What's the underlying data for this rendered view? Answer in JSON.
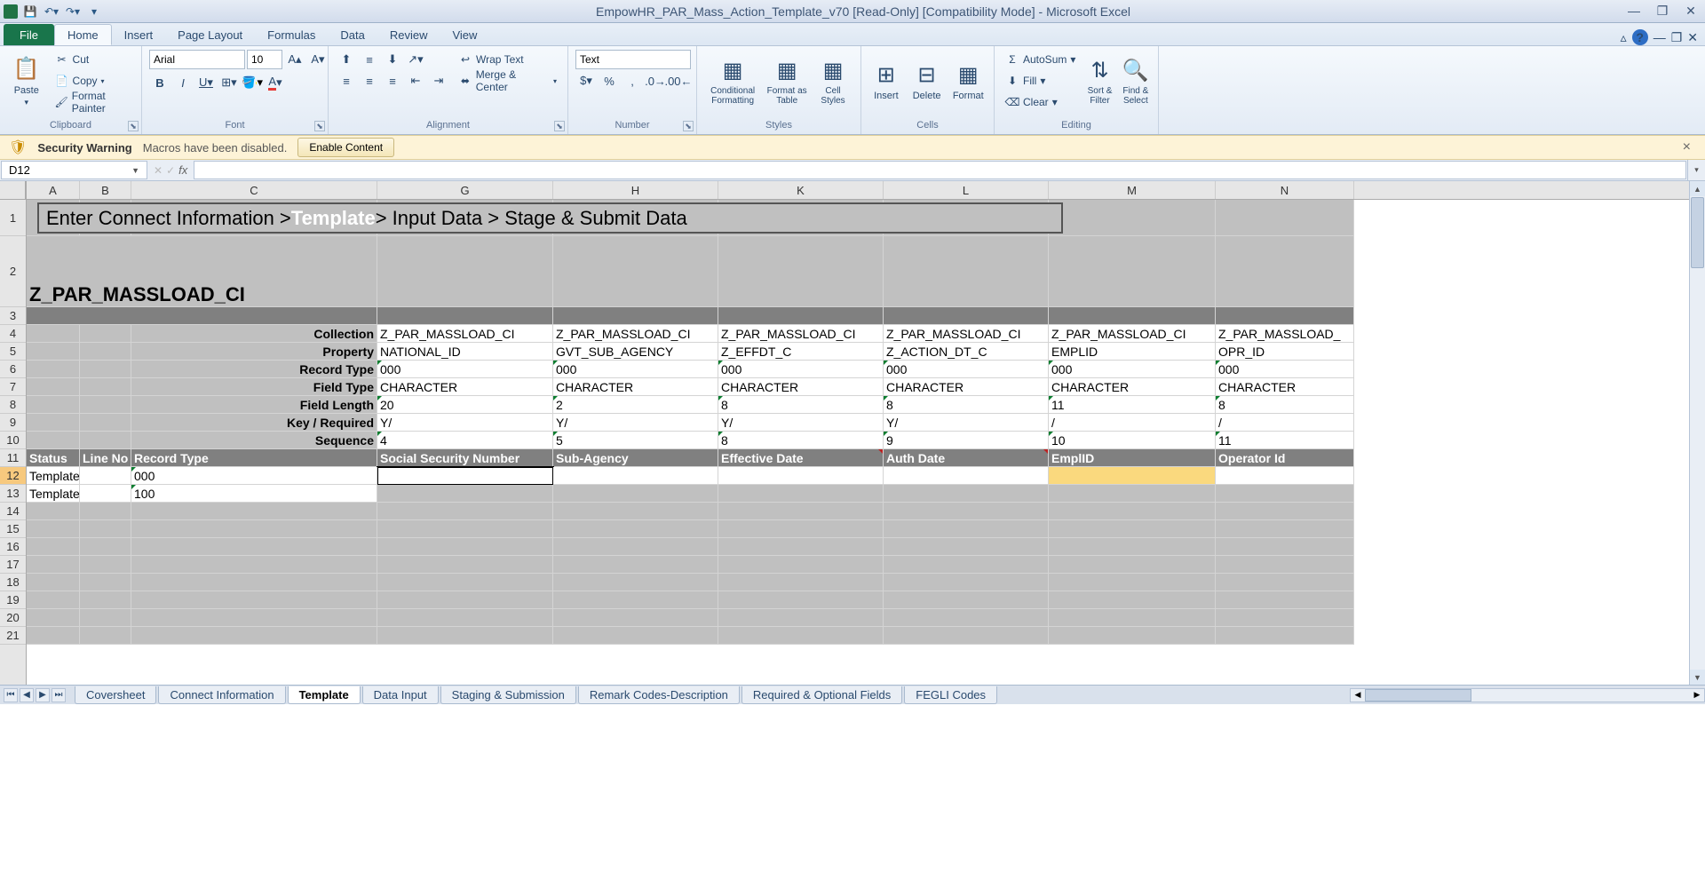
{
  "title": "EmpowHR_PAR_Mass_Action_Template_v70  [Read-Only]  [Compatibility Mode] - Microsoft Excel",
  "tabs": {
    "file": "File",
    "home": "Home",
    "insert": "Insert",
    "pagelayout": "Page Layout",
    "formulas": "Formulas",
    "data": "Data",
    "review": "Review",
    "view": "View"
  },
  "clipboard": {
    "paste": "Paste",
    "cut": "Cut",
    "copy": "Copy",
    "format_painter": "Format Painter",
    "label": "Clipboard"
  },
  "font": {
    "name": "Arial",
    "size": "10",
    "label": "Font"
  },
  "alignment": {
    "wrap": "Wrap Text",
    "merge": "Merge & Center",
    "label": "Alignment"
  },
  "number": {
    "format": "Text",
    "label": "Number"
  },
  "styles": {
    "cond": "Conditional Formatting",
    "table": "Format as Table",
    "cell": "Cell Styles",
    "label": "Styles"
  },
  "cells": {
    "insert": "Insert",
    "delete": "Delete",
    "format": "Format",
    "label": "Cells"
  },
  "editing": {
    "autosum": "AutoSum",
    "fill": "Fill",
    "clear": "Clear",
    "sort": "Sort & Filter",
    "find": "Find & Select",
    "label": "Editing"
  },
  "security": {
    "title": "Security Warning",
    "msg": "Macros have been disabled.",
    "btn": "Enable Content"
  },
  "namebox": "D12",
  "columns": [
    "A",
    "B",
    "C",
    "G",
    "H",
    "K",
    "L",
    "M",
    "N"
  ],
  "breadcrumb": {
    "p1": "Enter Connect Information > ",
    "active": "Template",
    "p2": " > Input Data > Stage & Submit Data"
  },
  "ci_title": "Z_PAR_MASSLOAD_CI",
  "meta_labels": {
    "collection": "Collection",
    "property": "Property",
    "record_type": "Record Type",
    "field_type": "Field Type",
    "field_length": "Field Length",
    "key_req": "Key / Required",
    "sequence": "Sequence"
  },
  "meta": {
    "collection": [
      "Z_PAR_MASSLOAD_CI",
      "Z_PAR_MASSLOAD_CI",
      "Z_PAR_MASSLOAD_CI",
      "Z_PAR_MASSLOAD_CI",
      "Z_PAR_MASSLOAD_CI",
      "Z_PAR_MASSLOAD_"
    ],
    "property": [
      "NATIONAL_ID",
      "GVT_SUB_AGENCY",
      "Z_EFFDT_C",
      "Z_ACTION_DT_C",
      "EMPLID",
      "OPR_ID"
    ],
    "record_type": [
      "000",
      "000",
      "000",
      "000",
      "000",
      "000"
    ],
    "field_type": [
      "CHARACTER",
      "CHARACTER",
      "CHARACTER",
      "CHARACTER",
      "CHARACTER",
      "CHARACTER"
    ],
    "field_length": [
      "20",
      "2",
      "8",
      "8",
      "11",
      "8"
    ],
    "key_req": [
      "Y/",
      "Y/",
      "Y/",
      "Y/",
      "/",
      "/"
    ],
    "sequence": [
      "4",
      "5",
      "8",
      "9",
      "10",
      "11"
    ]
  },
  "grid_headers": {
    "status": "Status",
    "line_no": "Line No",
    "record_type": "Record Type",
    "ssn": "Social Security Number",
    "sub_agency": "Sub-Agency",
    "eff_date": "Effective Date",
    "auth_date": "Auth Date",
    "emplid": "EmplID",
    "operator": "Operator Id"
  },
  "data_rows": [
    {
      "status": "Template",
      "line_no": "",
      "record_type": "000"
    },
    {
      "status": "Template",
      "line_no": "",
      "record_type": "100"
    }
  ],
  "sheet_tabs": [
    "Coversheet",
    "Connect Information",
    "Template",
    "Data Input",
    "Staging & Submission",
    "Remark Codes-Description",
    "Required & Optional Fields",
    "FEGLI Codes"
  ],
  "row_nums": [
    "1",
    "2",
    "3",
    "4",
    "5",
    "6",
    "7",
    "8",
    "9",
    "10",
    "11",
    "12",
    "13",
    "14",
    "15",
    "16",
    "17",
    "18",
    "19",
    "20",
    "21"
  ]
}
